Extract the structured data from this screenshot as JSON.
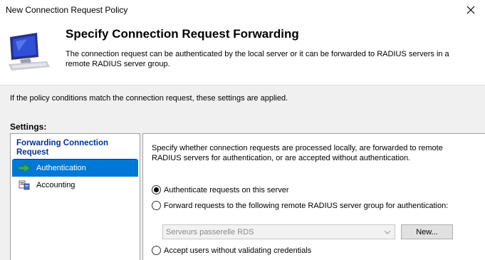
{
  "window": {
    "title": "New Connection Request Policy"
  },
  "header": {
    "heading": "Specify Connection Request Forwarding",
    "description": "The connection request can be authenticated by the local server or it can be forwarded to RADIUS servers in a remote RADIUS server group."
  },
  "intro_text": "If the policy conditions match the connection request, these settings are applied.",
  "settings_label": "Settings:",
  "sidebar": {
    "group_title": "Forwarding Connection Request",
    "items": [
      {
        "label": "Authentication",
        "icon": "green-arrow-icon",
        "selected": true
      },
      {
        "label": "Accounting",
        "icon": "accounting-icon",
        "selected": false
      }
    ]
  },
  "panel": {
    "description": "Specify whether connection requests are processed locally, are forwarded to remote RADIUS servers for authentication, or are accepted without authentication.",
    "options": [
      {
        "label": "Authenticate requests on this server",
        "checked": true
      },
      {
        "label": "Forward requests to the following remote RADIUS server group for authentication:",
        "checked": false
      },
      {
        "label": "Accept users without validating credentials",
        "checked": false
      }
    ],
    "server_group_select": {
      "value": "Serveurs passerelle RDS",
      "disabled": true
    },
    "new_button_label": "New..."
  },
  "colors": {
    "selected_bg": "#0078d7",
    "group_title": "#003399"
  }
}
